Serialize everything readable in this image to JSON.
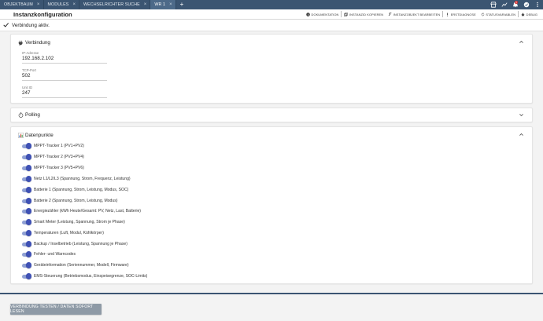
{
  "tabs": [
    {
      "label": "OBJEKTBAUM",
      "active": false
    },
    {
      "label": "MODULES",
      "active": false
    },
    {
      "label": "WECHSELRICHTER SUCHE",
      "active": false
    },
    {
      "label": "WR 1",
      "active": true
    }
  ],
  "notifications_count": "1",
  "header": {
    "title": "Instanzkonfiguration",
    "actions": [
      {
        "label": "DOKUMENTATION",
        "icon": "info-icon"
      },
      {
        "label": "INSTANZID KOPIEREN",
        "icon": "copy-icon"
      },
      {
        "label": "INSTANZOBJEKT BEARBEITEN",
        "icon": "wrench-icon"
      },
      {
        "label": "ERSTDIAGNOSE",
        "icon": "alert-icon"
      },
      {
        "label": "STATUSVARIABLEN",
        "icon": "refresh-icon"
      },
      {
        "label": "DEBUG",
        "icon": "bug-icon"
      }
    ]
  },
  "status": {
    "text": "Verbindung aktiv."
  },
  "verbindung": {
    "title": "Verbindung",
    "fields": [
      {
        "label": "IP-Adresse",
        "value": "192.168.2.102"
      },
      {
        "label": "TCP-Port",
        "value": "502"
      },
      {
        "label": "Unit ID",
        "value": "247"
      }
    ]
  },
  "polling": {
    "title": "Polling"
  },
  "datenpunkte": {
    "title": "Datenpunkte",
    "items": [
      {
        "label": "MPPT-Tracker 1 (PV1+PV2)",
        "enabled": true
      },
      {
        "label": "MPPT-Tracker 2 (PV3+PV4)",
        "enabled": true
      },
      {
        "label": "MPPT-Tracker 3 (PV5+PV6)",
        "enabled": true
      },
      {
        "label": "Netz L1/L2/L3 (Spannung, Strom, Frequenz, Leistung)",
        "enabled": true
      },
      {
        "label": "Batterie 1 (Spannung, Strom, Leistung, Modus, SOC)",
        "enabled": true
      },
      {
        "label": "Batterie 2 (Spannung, Strom, Leistung, Modus)",
        "enabled": true
      },
      {
        "label": "Energiezähler (kWh Heute/Gesamt: PV, Netz, Last, Batterie)",
        "enabled": true
      },
      {
        "label": "Smart Meter (Leistung, Spannung, Strom je Phase)",
        "enabled": true
      },
      {
        "label": "Temperaturen (Luft, Modul, Kühlkörper)",
        "enabled": true
      },
      {
        "label": "Backup / Inselbetrieb (Leistung, Spannung je Phase)",
        "enabled": true
      },
      {
        "label": "Fehler- und Warncodes",
        "enabled": true
      },
      {
        "label": "Geräteinformation (Seriennummer, Modell, Firmware)",
        "enabled": true
      },
      {
        "label": "EMS-Steuerung (Betriebsmodus, Einspeisegrenze, SOC-Limits)",
        "enabled": true
      }
    ]
  },
  "bottom": {
    "test_button": "VERBINDUNG TESTEN / DATEN SOFORT LESEN"
  }
}
